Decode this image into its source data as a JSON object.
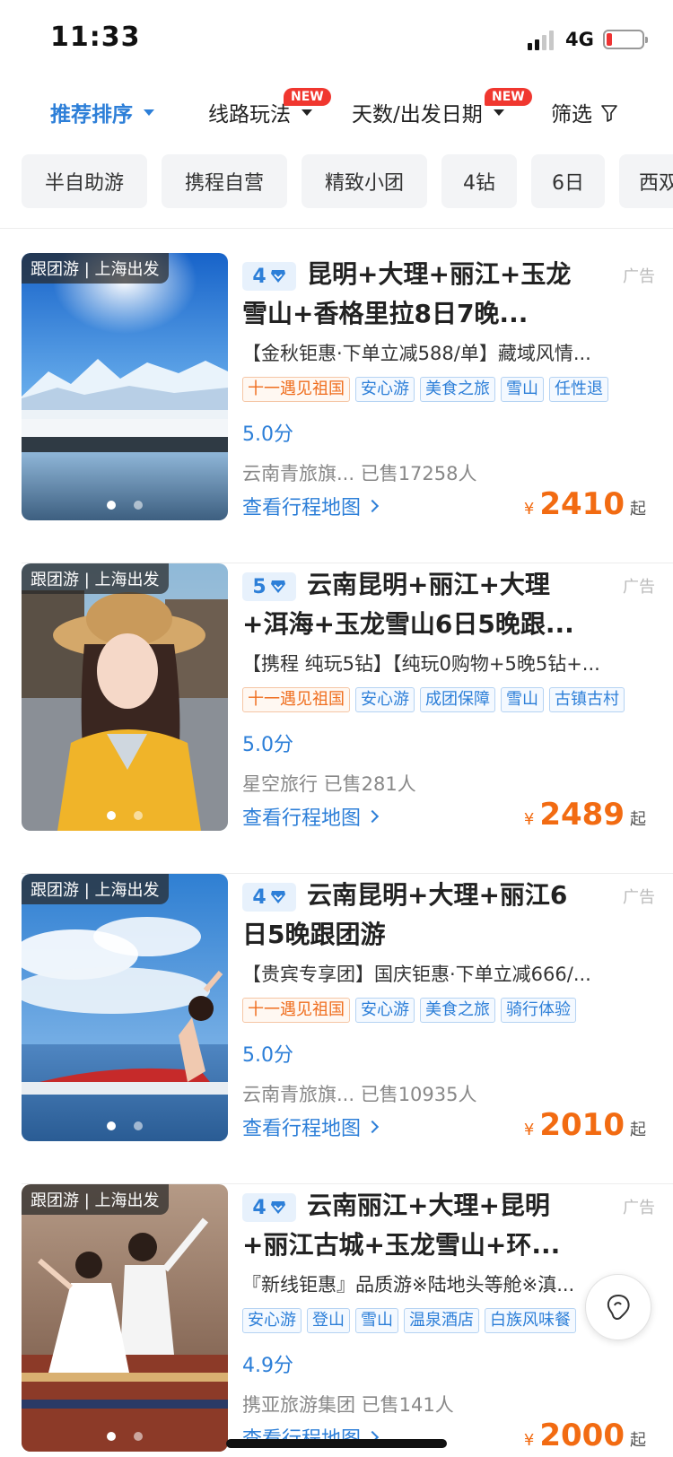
{
  "status": {
    "time": "11:33",
    "network": "4G"
  },
  "sortbar": {
    "items": [
      {
        "label": "推荐排序",
        "active": true
      },
      {
        "label": "线路玩法",
        "badge": "NEW"
      },
      {
        "label": "天数/出发日期",
        "badge": "NEW"
      },
      {
        "label": "筛选"
      }
    ]
  },
  "chips": [
    "半自助游",
    "携程自营",
    "精致小团",
    "4钻",
    "6日",
    "西双"
  ],
  "products": [
    {
      "tag": "跟团游 | 上海出发",
      "diamond": "4",
      "title": "昆明+大理+丽江+玉龙雪山+香格里拉8日7晚...",
      "ad": "广告",
      "desc": "【金秋钜惠·下单立减588/单】藏域风情...",
      "tags": [
        {
          "text": "十一遇见祖国",
          "style": "orange"
        },
        {
          "text": "安心游",
          "style": "blue"
        },
        {
          "text": "美食之旅",
          "style": "blue"
        },
        {
          "text": "雪山",
          "style": "blue"
        },
        {
          "text": "任性退",
          "style": "blue"
        }
      ],
      "score": "5.0分",
      "vendor": "云南青旅旗... 已售17258人",
      "map_link": "查看行程地图",
      "price_symbol": "¥",
      "price": "2410",
      "price_suffix": "起"
    },
    {
      "tag": "跟团游 | 上海出发",
      "diamond": "5",
      "title": "云南昆明+丽江+大理+洱海+玉龙雪山6日5晚跟...",
      "ad": "广告",
      "desc": "【携程 纯玩5钻】【纯玩0购物+5晚5钻+...",
      "tags": [
        {
          "text": "十一遇见祖国",
          "style": "orange"
        },
        {
          "text": "安心游",
          "style": "blue"
        },
        {
          "text": "成团保障",
          "style": "blue"
        },
        {
          "text": "雪山",
          "style": "blue"
        },
        {
          "text": "古镇古村",
          "style": "blue"
        }
      ],
      "score": "5.0分",
      "vendor": "星空旅行 已售281人",
      "map_link": "查看行程地图",
      "price_symbol": "¥",
      "price": "2489",
      "price_suffix": "起"
    },
    {
      "tag": "跟团游 | 上海出发",
      "diamond": "4",
      "title": "云南昆明+大理+丽江6日5晚跟团游",
      "ad": "广告",
      "desc": "【贵宾专享团】国庆钜惠·下单立减666/...",
      "tags": [
        {
          "text": "十一遇见祖国",
          "style": "orange"
        },
        {
          "text": "安心游",
          "style": "blue"
        },
        {
          "text": "美食之旅",
          "style": "blue"
        },
        {
          "text": "骑行体验",
          "style": "blue"
        }
      ],
      "score": "5.0分",
      "vendor": "云南青旅旗... 已售10935人",
      "map_link": "查看行程地图",
      "price_symbol": "¥",
      "price": "2010",
      "price_suffix": "起"
    },
    {
      "tag": "跟团游 | 上海出发",
      "diamond": "4",
      "title": "云南丽江+大理+昆明+丽江古城+玉龙雪山+环...",
      "ad": "广告",
      "desc": "『新线钜惠』品质游※陆地头等舱※滇...",
      "tags": [
        {
          "text": "安心游",
          "style": "blue"
        },
        {
          "text": "登山",
          "style": "blue"
        },
        {
          "text": "雪山",
          "style": "blue"
        },
        {
          "text": "温泉酒店",
          "style": "blue"
        },
        {
          "text": "白族风味餐",
          "style": "blue"
        }
      ],
      "score": "4.9分",
      "vendor": "携亚旅游集团 已售141人",
      "map_link": "查看行程地图",
      "price_symbol": "¥",
      "price": "2000",
      "price_suffix": "起"
    }
  ]
}
